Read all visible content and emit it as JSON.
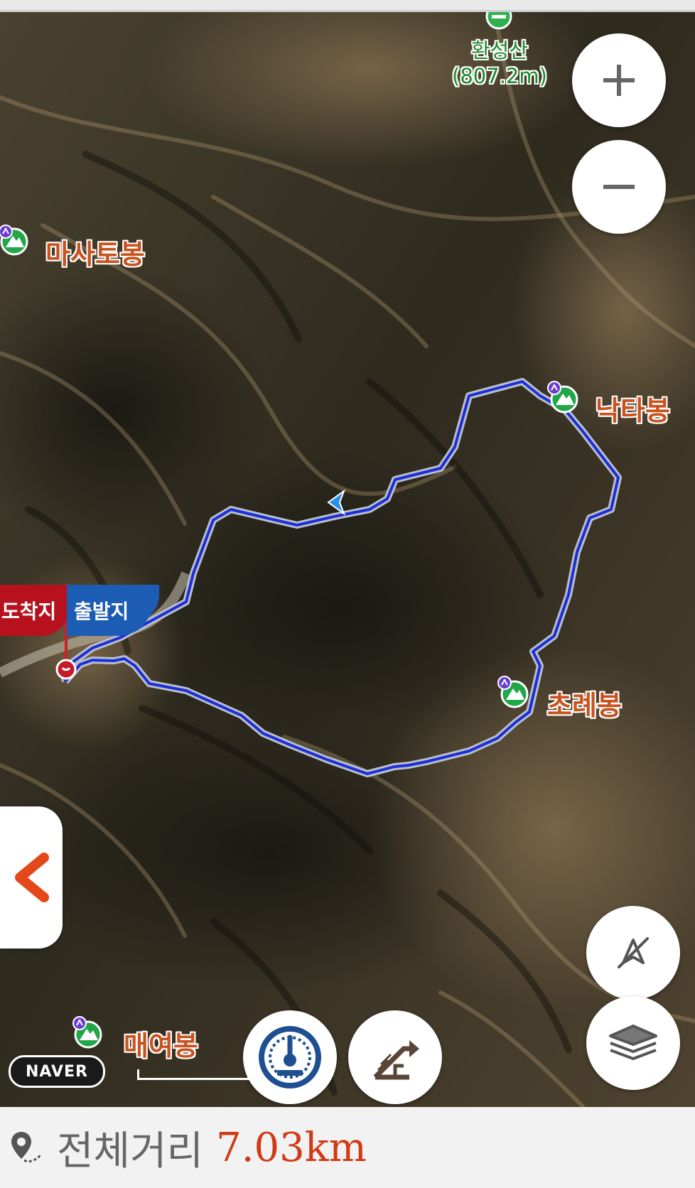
{
  "map": {
    "summit": {
      "name": "환성산",
      "elevation": "(807.2m)"
    },
    "peaks": [
      {
        "id": "masatobong",
        "name": "마사토봉"
      },
      {
        "id": "naktabong",
        "name": "낙타봉"
      },
      {
        "id": "chorebong",
        "name": "초례봉"
      },
      {
        "id": "maeyeobong",
        "name": "매여봉"
      }
    ],
    "flags": {
      "arrival": "도착지",
      "departure": "출발지"
    },
    "attribution": "NAVER",
    "route_color": "#1f2fd6",
    "route_casing_color": "#b9c0cc",
    "peak_label_color": "#c8531f",
    "summit_label_color": "#1f8a2a"
  },
  "controls": {
    "zoom_in_icon": "plus-icon",
    "zoom_out_icon": "minus-icon",
    "back_icon": "chevron-left-icon",
    "compass_icon": "compass-off-icon",
    "layers_icon": "layers-icon",
    "speed_icon": "speedometer-icon",
    "elevation_icon": "elevation-profile-icon"
  },
  "summary": {
    "label": "전체거리",
    "distance": "7.03km"
  }
}
